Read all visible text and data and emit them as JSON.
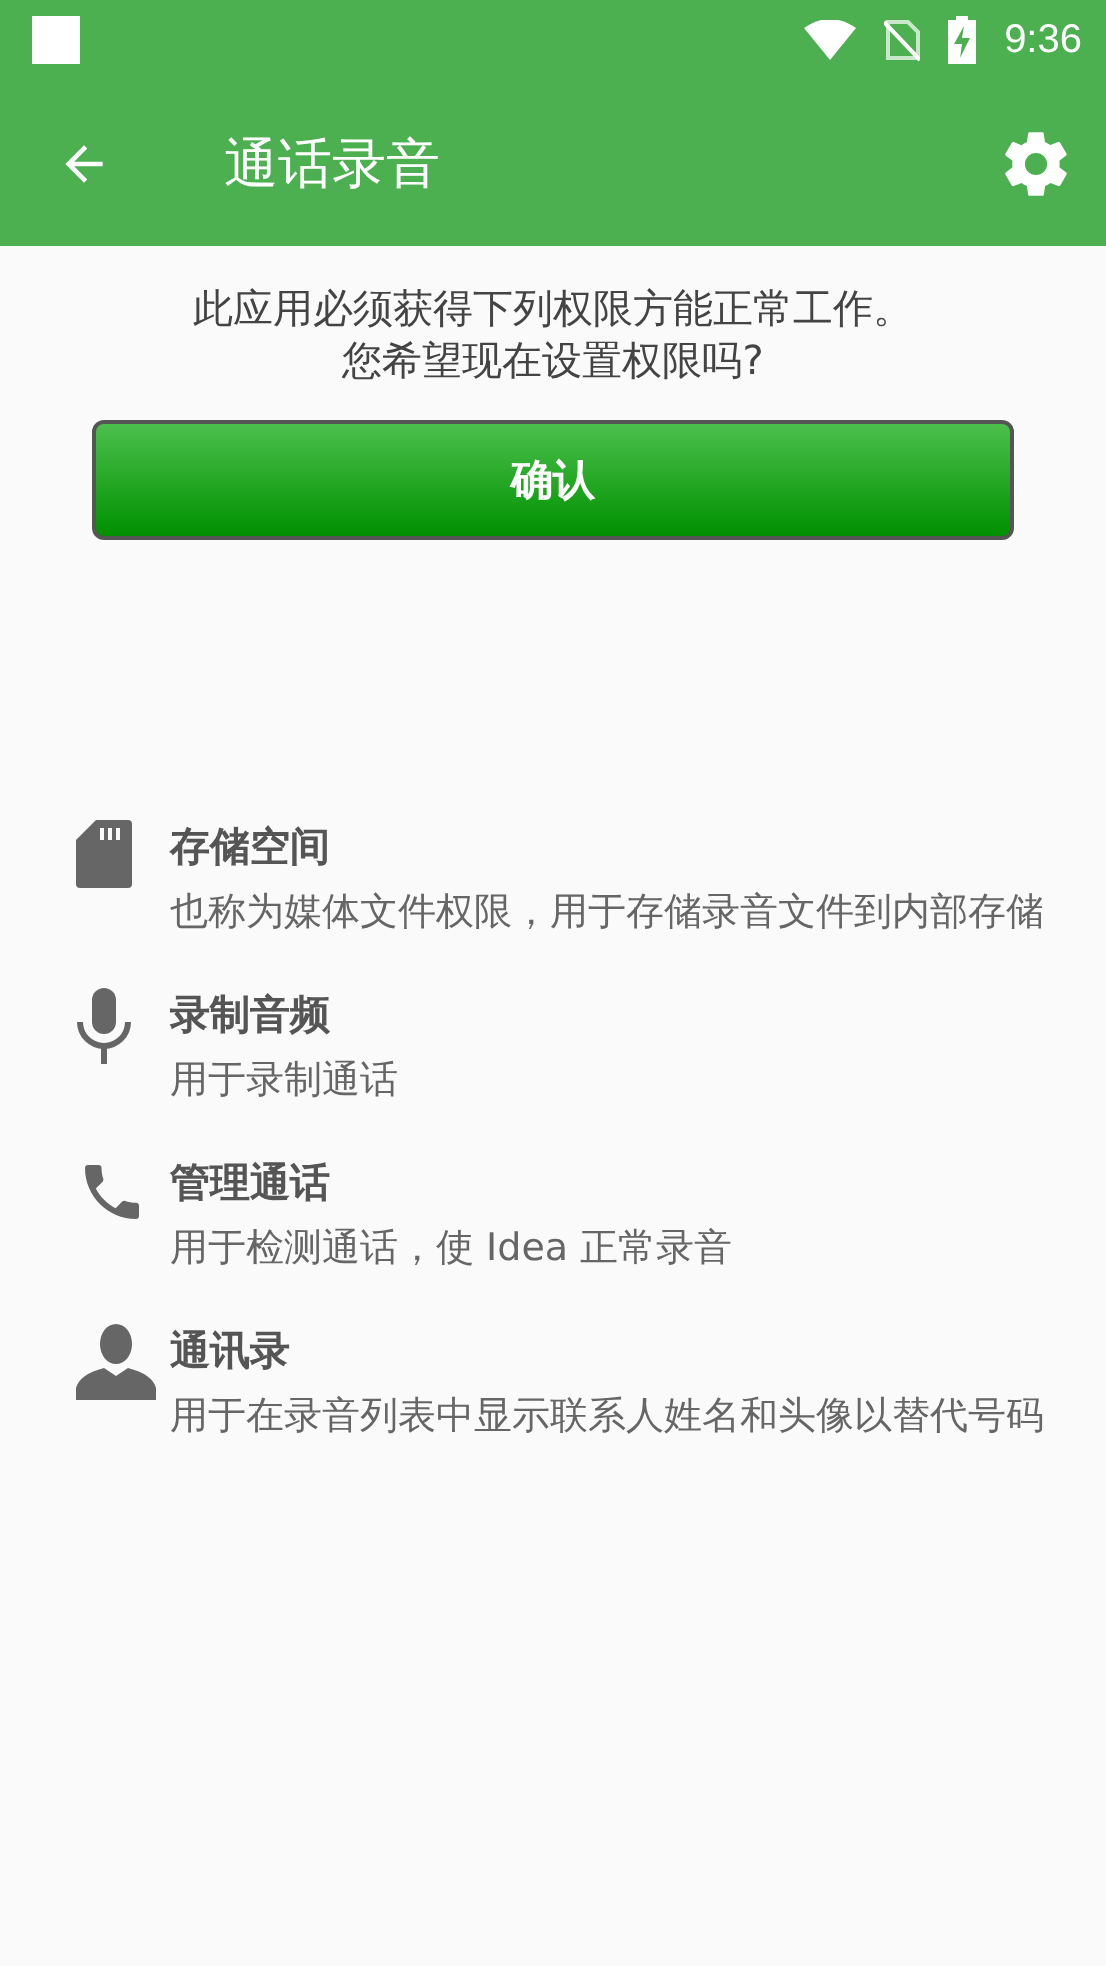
{
  "status_bar": {
    "time": "9:36"
  },
  "app_bar": {
    "title": "通话录音"
  },
  "message": {
    "lines": [
      "此应用必须获得下列权限方能正常工作。",
      "您希望现在设置权限吗?"
    ]
  },
  "confirm_button": {
    "label": "确认"
  },
  "permissions": [
    {
      "kind": "storage",
      "title": "存储空间",
      "description": "也称为媒体文件权限，用于存储录音文件到内部存储"
    },
    {
      "kind": "microphone",
      "title": "录制音频",
      "description": "用于录制通话"
    },
    {
      "kind": "phone",
      "title": "管理通话",
      "description": "用于检测通话，使 Idea 正常录音"
    },
    {
      "kind": "contacts",
      "title": "通讯录",
      "description": "用于在录音列表中显示联系人姓名和头像以替代号码"
    }
  ]
}
